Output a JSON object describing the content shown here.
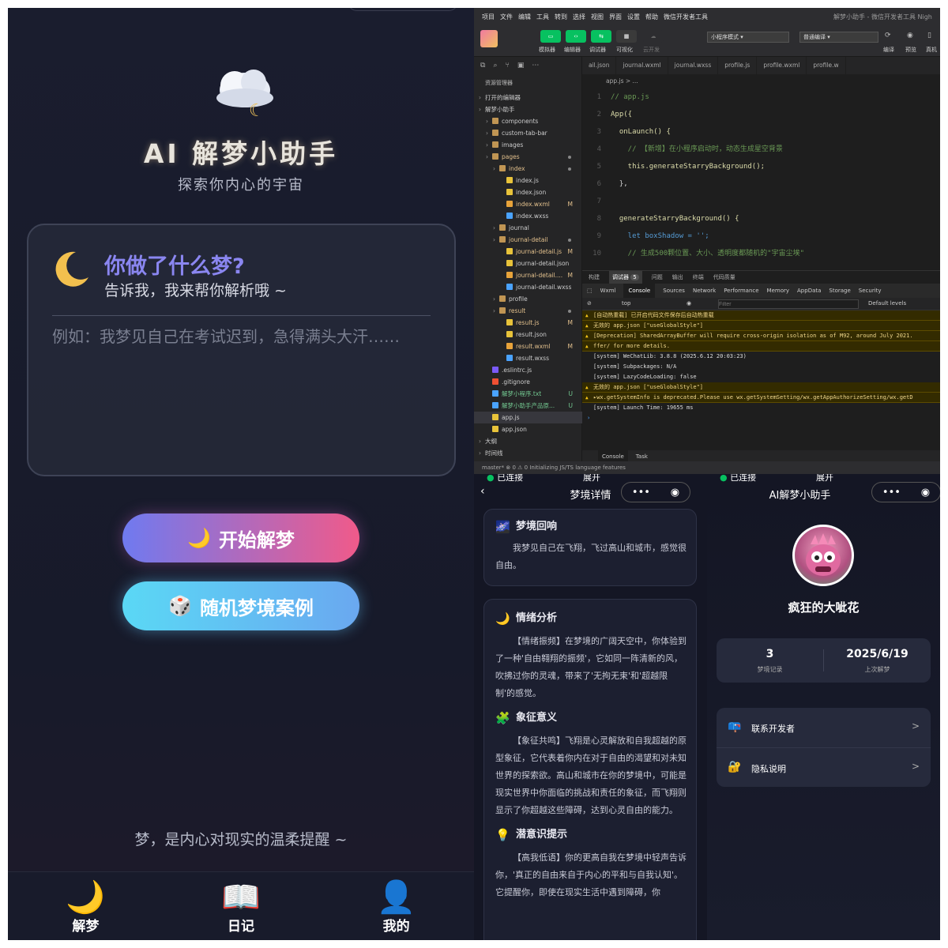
{
  "home": {
    "title": "AI 解梦小助手",
    "subtitle": "探索你内心的宇宙",
    "prompt_title": "你做了什么梦?",
    "prompt_sub": "告诉我，我来帮你解析哦 ~",
    "input_placeholder": "例如：我梦见自己在考试迟到，急得满头大汗……",
    "start_button": "开始解梦",
    "random_button": "随机梦境案例",
    "footer_quote": "梦，是内心对现实的温柔提醒 ~",
    "tabs": [
      {
        "label": "解梦",
        "icon": "moon-icon"
      },
      {
        "label": "日记",
        "icon": "book-icon"
      },
      {
        "label": "我的",
        "icon": "user-icon"
      }
    ]
  },
  "ide": {
    "menu": [
      "项目",
      "文件",
      "编辑",
      "工具",
      "转到",
      "选择",
      "视图",
      "界面",
      "设置",
      "帮助",
      "微信开发者工具"
    ],
    "window_title": "解梦小助手 - 微信开发者工具 Nigh",
    "toolbar": {
      "simulator": "模拟器",
      "editor": "编辑器",
      "debugger": "调试器",
      "visual": "可视化",
      "cloud": "云开发",
      "mode": "小程序模式",
      "compile": "普通编译",
      "compile_btn": "编译",
      "preview": "预览",
      "real": "真机"
    },
    "explorer_title": "资源管理器",
    "tree": [
      {
        "label": "打开的编辑器",
        "indent": 0,
        "type": "section"
      },
      {
        "label": "解梦小助手",
        "indent": 0,
        "type": "section"
      },
      {
        "label": "components",
        "indent": 1,
        "type": "folder"
      },
      {
        "label": "custom-tab-bar",
        "indent": 1,
        "type": "folder"
      },
      {
        "label": "images",
        "indent": 1,
        "type": "folder"
      },
      {
        "label": "pages",
        "indent": 1,
        "type": "folder",
        "color": "orange",
        "dot": true
      },
      {
        "label": "index",
        "indent": 2,
        "type": "folder",
        "color": "orange",
        "dot": true
      },
      {
        "label": "index.js",
        "indent": 3,
        "type": "js"
      },
      {
        "label": "index.json",
        "indent": 3,
        "type": "json"
      },
      {
        "label": "index.wxml",
        "indent": 3,
        "type": "wxml",
        "color": "orange",
        "badge": "M"
      },
      {
        "label": "index.wxss",
        "indent": 3,
        "type": "wxss"
      },
      {
        "label": "journal",
        "indent": 2,
        "type": "folder"
      },
      {
        "label": "journal-detail",
        "indent": 2,
        "type": "folder",
        "color": "orange",
        "dot": true
      },
      {
        "label": "journal-detail.js",
        "indent": 3,
        "type": "js",
        "color": "orange",
        "badge": "M"
      },
      {
        "label": "journal-detail.json",
        "indent": 3,
        "type": "json"
      },
      {
        "label": "journal-detail....",
        "indent": 3,
        "type": "wxml",
        "color": "orange",
        "badge": "M"
      },
      {
        "label": "journal-detail.wxss",
        "indent": 3,
        "type": "wxss"
      },
      {
        "label": "profile",
        "indent": 2,
        "type": "folder"
      },
      {
        "label": "result",
        "indent": 2,
        "type": "folder",
        "color": "orange",
        "dot": true
      },
      {
        "label": "result.js",
        "indent": 3,
        "type": "js",
        "color": "orange",
        "badge": "M"
      },
      {
        "label": "result.json",
        "indent": 3,
        "type": "json"
      },
      {
        "label": "result.wxml",
        "indent": 3,
        "type": "wxml",
        "color": "orange",
        "badge": "M"
      },
      {
        "label": "result.wxss",
        "indent": 3,
        "type": "wxss"
      },
      {
        "label": ".eslintrc.js",
        "indent": 1,
        "type": "eslint"
      },
      {
        "label": ".gitignore",
        "indent": 1,
        "type": "git"
      },
      {
        "label": "解梦小程序.txt",
        "indent": 1,
        "type": "txt",
        "color": "green",
        "badge": "U"
      },
      {
        "label": "解梦小助手产品原...",
        "indent": 1,
        "type": "txt",
        "color": "green",
        "badge": "U"
      },
      {
        "label": "app.js",
        "indent": 1,
        "type": "js",
        "selected": true
      },
      {
        "label": "app.json",
        "indent": 1,
        "type": "json"
      },
      {
        "label": "大纲",
        "indent": 0,
        "type": "section"
      },
      {
        "label": "时间线",
        "indent": 0,
        "type": "section"
      }
    ],
    "tabs": [
      "ail.json",
      "journal.wxml",
      "journal.wxss",
      "profile.js",
      "profile.wxml",
      "profile.w"
    ],
    "breadcrumb": "app.js > ...",
    "code": [
      {
        "n": "1",
        "text": "// app.js",
        "cls": "cm"
      },
      {
        "n": "2",
        "text": "App({",
        "cls": "fn"
      },
      {
        "n": "3",
        "text": "  onLaunch() {",
        "cls": "fn"
      },
      {
        "n": "4",
        "text": "    // 【新增】在小程序启动时，动态生成星空背景",
        "cls": "cm"
      },
      {
        "n": "5",
        "text": "    this.generateStarryBackground();",
        "cls": "fn"
      },
      {
        "n": "6",
        "text": "  },",
        "cls": "pu"
      },
      {
        "n": "7",
        "text": "",
        "cls": "pu"
      },
      {
        "n": "8",
        "text": "  generateStarryBackground() {",
        "cls": "fn"
      },
      {
        "n": "9",
        "text": "    let boxShadow = '';",
        "cls": "obj"
      },
      {
        "n": "10",
        "text": "    // 生成500颗位置、大小、透明度都随机的\"宇宙尘埃\"",
        "cls": "cm"
      }
    ],
    "panel_tabs": [
      "构建",
      "调试器",
      "问题",
      "输出",
      "终端",
      "代码质量"
    ],
    "debug_badge": "5",
    "devtools_tabs": [
      "Wxml",
      "Console",
      "Sources",
      "Network",
      "Performance",
      "Memory",
      "AppData",
      "Storage",
      "Security"
    ],
    "context": "top",
    "filter_placeholder": "Filter",
    "levels": "Default levels",
    "logs": [
      {
        "type": "w",
        "text": "[自动热重载] 已开启代码文件保存后自动热重载"
      },
      {
        "type": "w",
        "text": "无效的 app.json [\"useGlobalStyle\"]"
      },
      {
        "type": "w",
        "text": "[Deprecation] SharedArrayBuffer will require cross-origin isolation as of M92, around July 2021."
      },
      {
        "type": "w",
        "text": "ffer/ for more details."
      },
      {
        "type": "i",
        "text": "[system] WeChatLib: 3.8.8 (2025.6.12 20:03:23)"
      },
      {
        "type": "i",
        "text": "[system] Subpackages: N/A"
      },
      {
        "type": "i",
        "text": "[system] LazyCodeLoading: false"
      },
      {
        "type": "w",
        "text": "无效的 app.json [\"useGlobalStyle\"]"
      },
      {
        "type": "w",
        "text": "▸wx.getSystemInfo is deprecated.Please use wx.getSystemSetting/wx.getAppAuthorizeSetting/wx.getD"
      },
      {
        "type": "i",
        "text": "[system] Launch Time: 19655 ms"
      }
    ],
    "bottom_tabs": [
      "Console",
      "Task"
    ],
    "status": "master*   ⊗ 0 ⚠ 0   Initializing JS/TS language features"
  },
  "detail": {
    "status_left": "已连接",
    "status_right": "展开",
    "title": "梦境详情",
    "recall_title": "梦境回响",
    "recall_text": "我梦见自己在飞翔，飞过高山和城市，感觉很自由。",
    "sections": [
      {
        "title": "情绪分析",
        "icon": "moon-icon",
        "glyph": "🌙",
        "text": "【情绪振频】在梦境的广阔天空中，你体验到了一种'自由翱翔的振频'，它如同一阵清新的风，吹拂过你的灵魂，带来了'无拘无束'和'超越限制'的感觉。"
      },
      {
        "title": "象征意义",
        "icon": "puzzle-icon",
        "glyph": "🧩",
        "text": "【象征共鸣】飞翔是心灵解放和自我超越的原型象征，它代表着你内在对于自由的渴望和对未知世界的探索欲。高山和城市在你的梦境中，可能是现实世界中你面临的挑战和责任的象征，而飞翔则显示了你超越这些障碍，达到心灵自由的能力。"
      },
      {
        "title": "潜意识提示",
        "icon": "bulb-icon",
        "glyph": "💡",
        "text": "【高我低语】你的更高自我在梦境中轻声告诉你，'真正的自由来自于内心的平和与自我认知'。它提醒你，即使在现实生活中遇到障碍，你"
      }
    ]
  },
  "profile": {
    "status_left": "已连接",
    "status_right": "展开",
    "title": "AI解梦小助手",
    "name": "疯狂的大呲花",
    "stats": [
      {
        "value": "3",
        "label": "梦境记录"
      },
      {
        "value": "2025/6/19",
        "label": "上次解梦"
      }
    ],
    "menu": [
      {
        "label": "联系开发者",
        "icon": "mailbox-icon",
        "glyph": "📪"
      },
      {
        "label": "隐私说明",
        "icon": "lock-icon",
        "glyph": "🔐"
      }
    ]
  }
}
